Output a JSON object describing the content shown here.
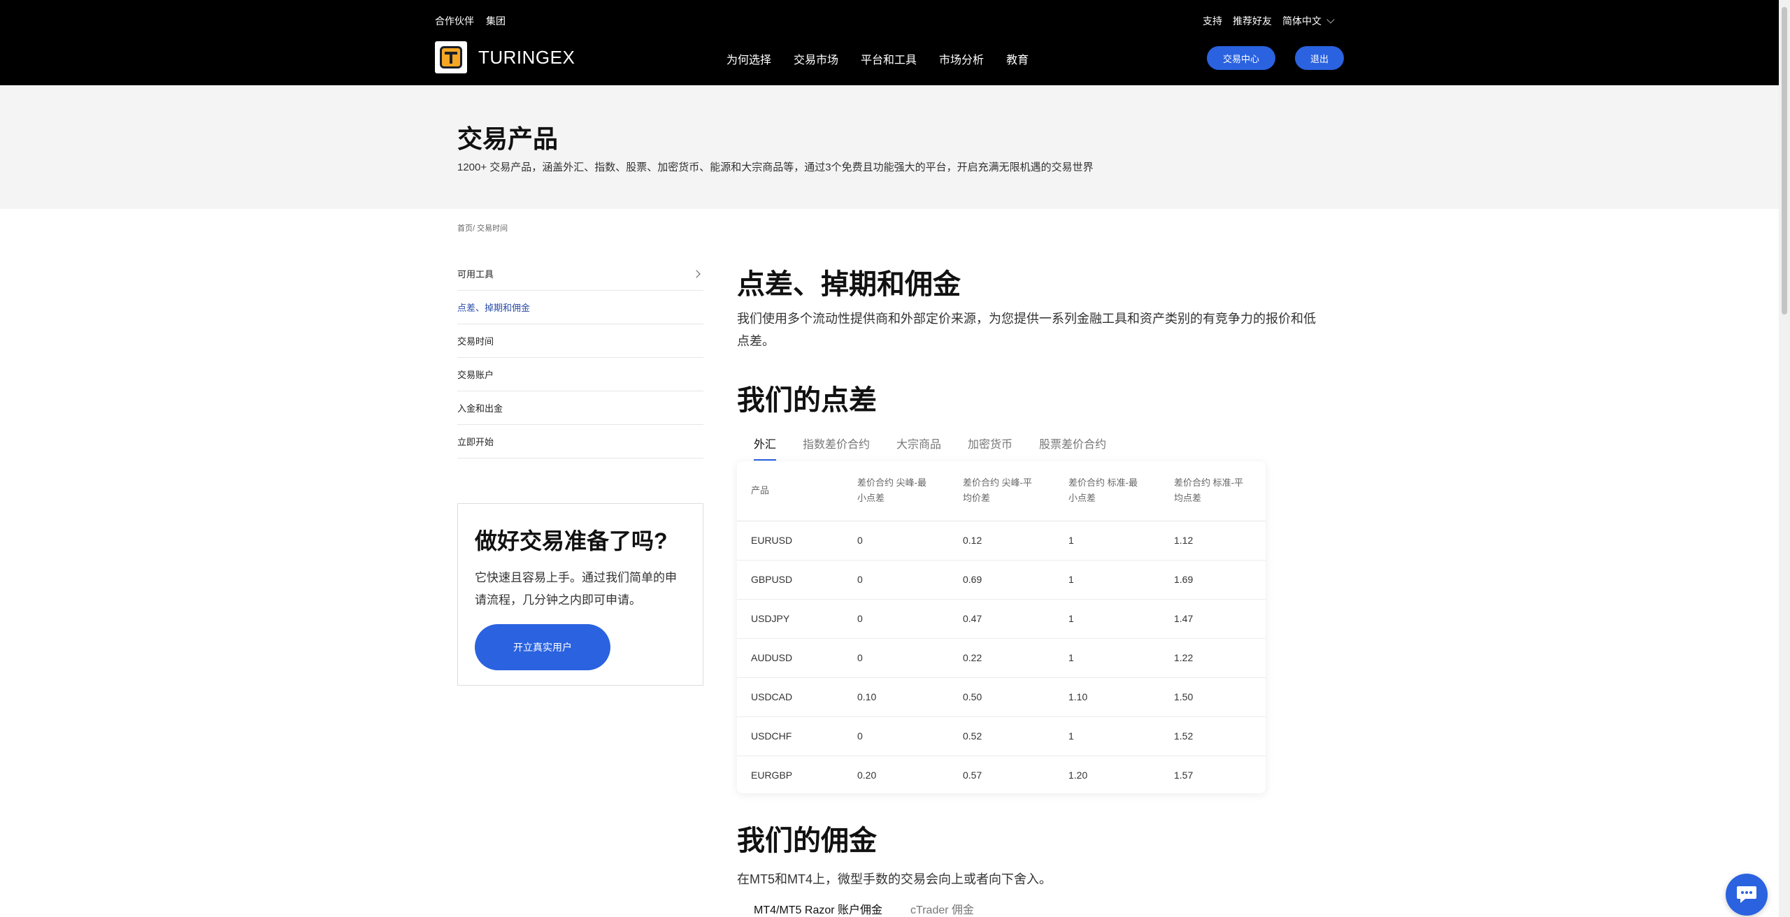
{
  "topbar": {
    "partner": "合作伙伴",
    "group": "集团",
    "support": "支持",
    "refer": "推荐好友",
    "language": "简体中文"
  },
  "brand": {
    "name": "TURINGEX"
  },
  "nav": [
    "为何选择",
    "交易市场",
    "平台和工具",
    "市场分析",
    "教育"
  ],
  "header_buttons": {
    "center": "交易中心",
    "exit": "退出"
  },
  "hero": {
    "title": "交易产品",
    "subtitle": "1200+ 交易产品，涵盖外汇、指数、股票、加密货币、能源和大宗商品等，通过3个免费且功能强大的平台，开启充满无限机遇的交易世界"
  },
  "breadcrumb": "首页/ 交易时间",
  "sidebar": {
    "items": [
      {
        "label": "可用工具"
      },
      {
        "label": "点差、掉期和佣金"
      },
      {
        "label": "交易时间"
      },
      {
        "label": "交易账户"
      },
      {
        "label": "入金和出金"
      },
      {
        "label": "立即开始"
      }
    ]
  },
  "ready": {
    "title": "做好交易准备了吗?",
    "text": "它快速且容易上手。通过我们简单的申请流程，几分钟之内即可申请。",
    "button": "开立真实用户"
  },
  "main": {
    "title": "点差、掉期和佣金",
    "desc": "我们使用多个流动性提供商和外部定价来源，为您提供一系列金融工具和资产类别的有竞争力的报价和低点差。"
  },
  "spreads": {
    "title": "我们的点差",
    "tabs": [
      "外汇",
      "指数差价合约",
      "大宗商品",
      "加密货币",
      "股票差价合约"
    ],
    "headers": [
      "产品",
      "差价合约 尖峰-最小点差",
      "差价合约 尖峰-平均价差",
      "差价合约 标准-最小点差",
      "差价合约 标准-平均点差"
    ],
    "rows": [
      [
        "EURUSD",
        "0",
        "0.12",
        "1",
        "1.12"
      ],
      [
        "GBPUSD",
        "0",
        "0.69",
        "1",
        "1.69"
      ],
      [
        "USDJPY",
        "0",
        "0.47",
        "1",
        "1.47"
      ],
      [
        "AUDUSD",
        "0",
        "0.22",
        "1",
        "1.22"
      ],
      [
        "USDCAD",
        "0.10",
        "0.50",
        "1.10",
        "1.50"
      ],
      [
        "USDCHF",
        "0",
        "0.52",
        "1",
        "1.52"
      ],
      [
        "EURGBP",
        "0.20",
        "0.57",
        "1.20",
        "1.57"
      ]
    ]
  },
  "commission": {
    "title": "我们的佣金",
    "desc": "在MT5和MT4上，微型手数的交易会向上或者向下舍入。",
    "tabs": [
      "MT4/MT5 Razor 账户佣金",
      "cTrader 佣金"
    ]
  }
}
